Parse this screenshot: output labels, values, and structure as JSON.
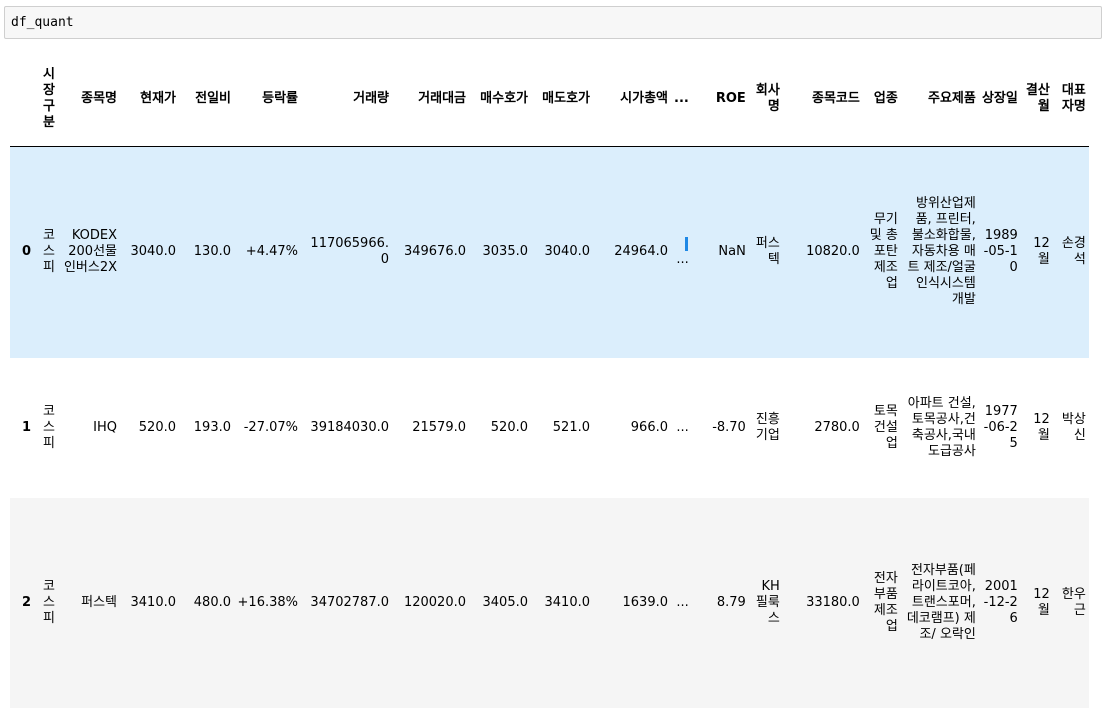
{
  "input_cell": {
    "code": "df_quant"
  },
  "table": {
    "columns": [
      "시장구분",
      "종목명",
      "현재가",
      "전일비",
      "등락률",
      "거래량",
      "거래대금",
      "매수호가",
      "매도호가",
      "시가총액",
      "...",
      "ROE",
      "회사명",
      "종목코드",
      "업종",
      "주요제품",
      "상장일",
      "결산월",
      "대표자명"
    ],
    "rows": [
      {
        "index": "0",
        "cells": [
          "코스피",
          "KODEX 200선물인버스2X",
          "3040.0",
          "130.0",
          "+4.47%",
          "117065966.0",
          "349676.0",
          "3035.0",
          "3040.0",
          "24964.0",
          "...",
          "NaN",
          "퍼스텍",
          "10820.0",
          "무기 및 총포탄 제조업",
          "방위산업제품, 프린터, 불소화합물,자동차용 매트 제조/얼굴인식시스템 개발",
          "1989-05-10",
          "12월",
          "손경석"
        ]
      },
      {
        "index": "1",
        "cells": [
          "코스피",
          "IHQ",
          "520.0",
          "193.0",
          "-27.07%",
          "39184030.0",
          "21579.0",
          "520.0",
          "521.0",
          "966.0",
          "...",
          "-8.70",
          "진흥기업",
          "2780.0",
          "토목 건설업",
          "아파트 건설,토목공사,건축공사,국내도급공사",
          "1977-06-25",
          "12월",
          "박상신"
        ]
      },
      {
        "index": "2",
        "cells": [
          "코스피",
          "퍼스텍",
          "3410.0",
          "480.0",
          "+16.38%",
          "34702787.0",
          "120020.0",
          "3405.0",
          "3410.0",
          "1639.0",
          "...",
          "8.79",
          "KH 필룩스",
          "33180.0",
          "전자부품 제조업",
          "전자부품(페라이트코아,트랜스포머,데코램프) 제조/ 오락인",
          "2001-12-26",
          "12월",
          "한우근"
        ]
      }
    ]
  }
}
